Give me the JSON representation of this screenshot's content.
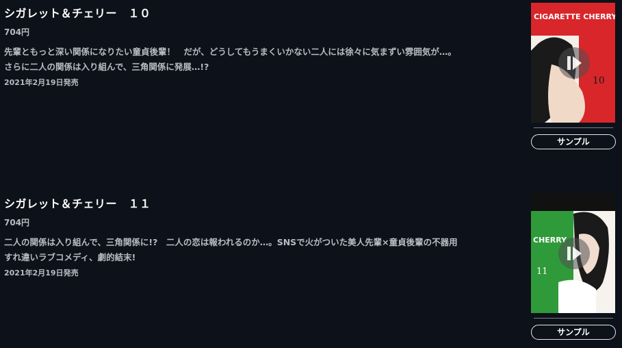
{
  "items": [
    {
      "title": "シガレット＆チェリー　１０",
      "price": "704円",
      "desc_line1": "先輩ともっと深い関係になりたい童貞後輩！　だが、どうしてもうまくいかない二人には徐々に気まずい雰囲気が…。",
      "desc_line2": "さらに二人の関係は入り組んで、三角関係に発展…!?",
      "date": "2021年2月19日発売",
      "cover_text": "CIGARETTE CHERRY",
      "cover_color": "#d8262a",
      "sample_label": "サンプル"
    },
    {
      "title": "シガレット＆チェリー　１１",
      "price": "704円",
      "desc_line1": "二人の関係は入り組んで、三角関係に!?　二人の恋は報われるのか…。SNSで火がついた美人先輩×童貞後輩の不器用",
      "desc_line2": "すれ違いラブコメディ、劇的結末!",
      "date": "2021年2月19日発売",
      "cover_text": "CHERRY",
      "cover_color": "#2f9a3a",
      "sample_label": "サンプル"
    }
  ]
}
